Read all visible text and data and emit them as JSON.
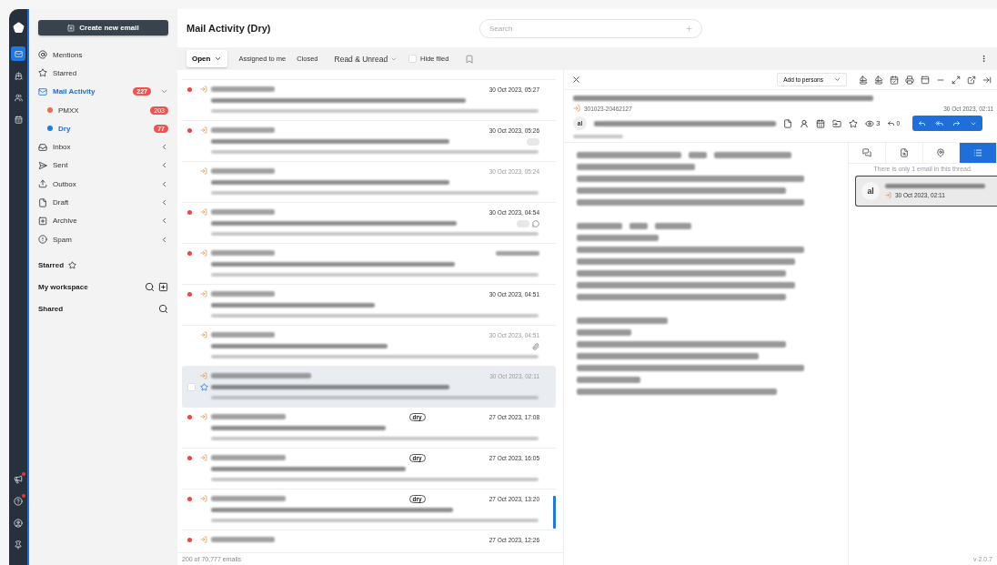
{
  "rail": {
    "top": [
      {
        "selected": true
      },
      {
        "selected": false
      },
      {
        "selected": false
      },
      {
        "selected": false
      }
    ],
    "bottom": [
      {
        "alert": true
      },
      {
        "alert": true
      },
      {
        "alert": false
      },
      {
        "alert": false
      }
    ]
  },
  "sidebar": {
    "create_button": "Create new email",
    "items": [
      {
        "label": "Mentions",
        "selected": false
      },
      {
        "label": "Starred",
        "selected": false
      },
      {
        "label": "Mail Activity",
        "count": "227",
        "selected": true,
        "expanded": true,
        "children": [
          {
            "label": "PMXX",
            "color": "#f26b4f",
            "count": "203",
            "selected": false
          },
          {
            "label": "Dry",
            "color": "#1a7ee6",
            "count": "77",
            "selected": true
          }
        ]
      },
      {
        "label": "Inbox",
        "selected": false,
        "expanded": false
      },
      {
        "label": "Sent",
        "selected": false,
        "expanded": false
      },
      {
        "label": "Outbox",
        "selected": false,
        "expanded": false
      },
      {
        "label": "Draft",
        "selected": false,
        "expanded": false
      },
      {
        "label": "Archive",
        "selected": false,
        "expanded": false
      },
      {
        "label": "Spam",
        "selected": false,
        "expanded": false
      }
    ],
    "sections": [
      {
        "label": "Starred"
      },
      {
        "label": "My workspace"
      },
      {
        "label": "Shared"
      }
    ]
  },
  "header": {
    "title": "Mail Activity (Dry)",
    "search": {
      "placeholder": "Search"
    }
  },
  "toolbar": {
    "status_dropdown": "Open",
    "filters": [
      "Assigned to me",
      "Closed"
    ],
    "read_dropdown": "Read & Unread",
    "hide_filed": {
      "label": "Hide filed",
      "checked": false
    }
  },
  "emails": [
    {
      "unread": true,
      "selected": false,
      "date": "30 Oct 2023, 05:27"
    },
    {
      "unread": true,
      "selected": false,
      "date": "30 Oct 2023, 05:26",
      "kind": "chip"
    },
    {
      "unread": false,
      "selected": false,
      "date": "30 Oct 2023, 05:24"
    },
    {
      "unread": true,
      "selected": false,
      "date": "30 Oct 2023, 04:54",
      "kind": "chip-comment"
    },
    {
      "unread": true,
      "selected": false
    },
    {
      "unread": true,
      "selected": false,
      "date": "30 Oct 2023, 04:51"
    },
    {
      "unread": false,
      "selected": false,
      "date": "30 Oct 2023, 04:51",
      "kind": "attachment"
    },
    {
      "unread": false,
      "selected": true,
      "date": "30 Oct 2023, 02:11"
    },
    {
      "unread": true,
      "selected": false,
      "date": "27 Oct 2023, 17:08",
      "tag": "dry"
    },
    {
      "unread": true,
      "selected": false,
      "date": "27 Oct 2023, 16:05",
      "tag": "dry"
    },
    {
      "unread": true,
      "selected": false,
      "date": "27 Oct 2023, 13:20",
      "tag": "dry"
    },
    {
      "unread": true,
      "selected": false,
      "date": "27 Oct 2023, 12:26"
    }
  ],
  "footer": {
    "count": "200 of 70,777 emails",
    "version": "v 2.0.7"
  },
  "reader": {
    "add_to_persons": "Add to persons",
    "reference": "301023-20462127",
    "date": "30 Oct 2023, 02:11",
    "avatar": "al",
    "views": "3",
    "replies": "0",
    "thread_tabs": [
      {
        "selected": false
      },
      {
        "selected": false
      },
      {
        "selected": false
      },
      {
        "selected": true
      }
    ],
    "thread_note": "There is only 1 email in this thread.",
    "thread": [
      {
        "avatar": "al",
        "date": "30 Oct 2023, 02:11",
        "selected": true
      }
    ]
  }
}
